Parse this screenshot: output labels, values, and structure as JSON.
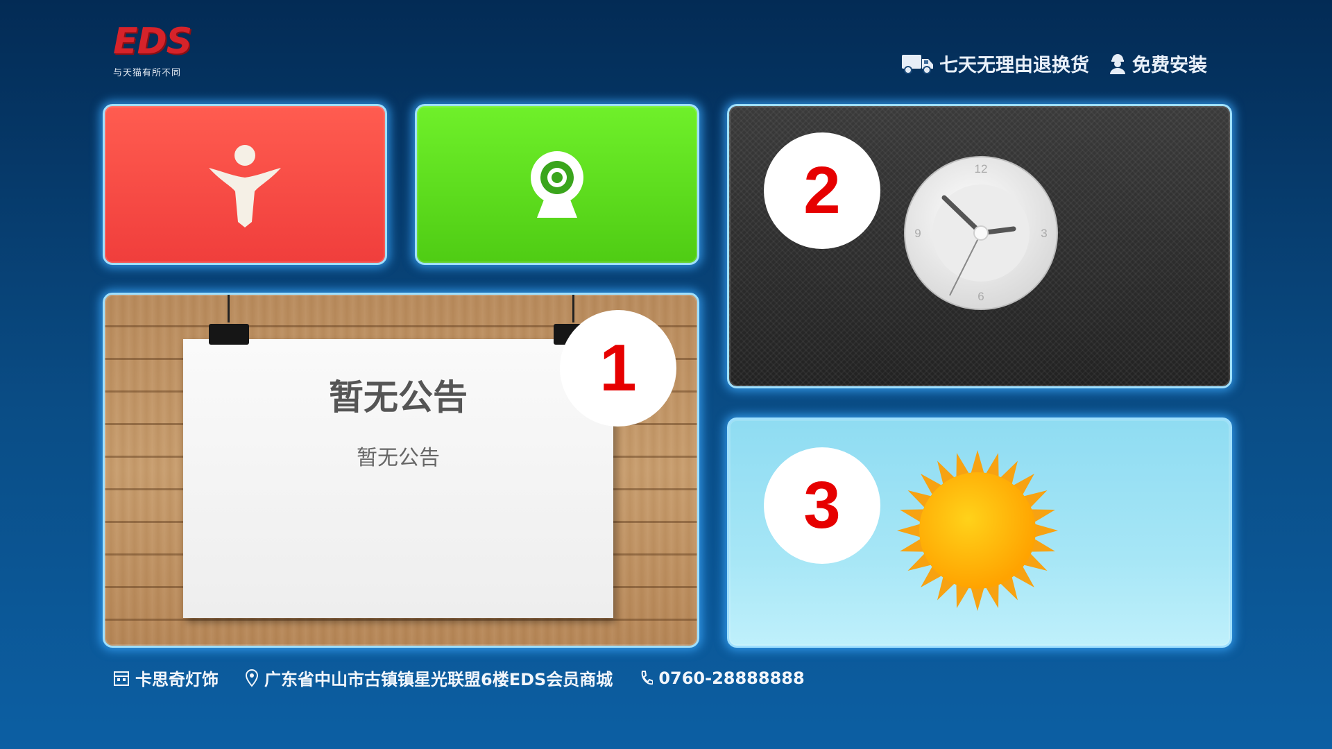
{
  "logo": {
    "mark": "EDS",
    "tagline": "与天猫有所不同"
  },
  "promos": [
    {
      "icon": "truck-icon",
      "label": "七天无理由退换货"
    },
    {
      "icon": "installer-icon",
      "label": "免费安装"
    }
  ],
  "tiles": {
    "red": {
      "icon": "person-icon",
      "color": "#f24a44"
    },
    "green": {
      "icon": "webcam-icon",
      "color": "#5ede1e"
    },
    "notice": {
      "title": "暂无公告",
      "body": "暂无公告",
      "badge": "1"
    },
    "clock": {
      "badge": "2",
      "numerals": [
        "12",
        "3",
        "6",
        "9"
      ]
    },
    "weather": {
      "badge": "3",
      "icon": "sun-icon"
    }
  },
  "footer": {
    "store": {
      "icon": "store-icon",
      "label": "卡思奇灯饰"
    },
    "address": {
      "icon": "location-icon",
      "label": "广东省中山市古镇镇星光联盟6楼EDS会员商城"
    },
    "phone": {
      "icon": "phone-icon",
      "label": "0760-28888888"
    }
  },
  "colors": {
    "badge_number": "#e60000",
    "tile_border": "#9fe0ff"
  }
}
